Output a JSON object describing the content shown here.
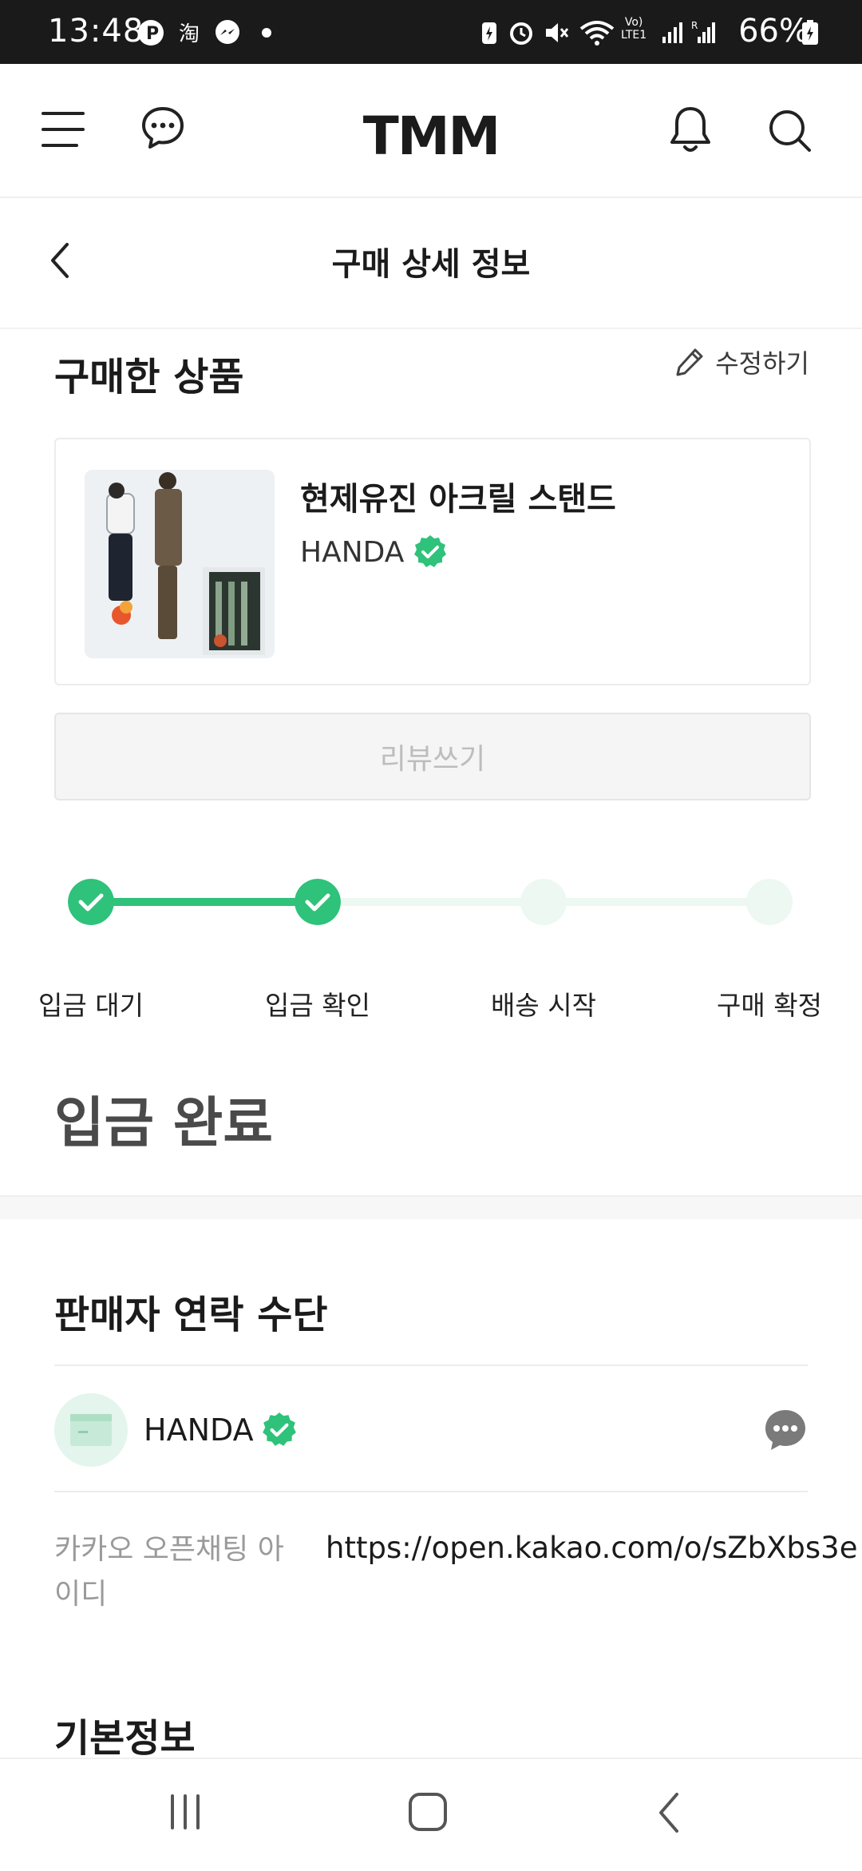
{
  "status_bar": {
    "time": "13:48",
    "battery": "66%",
    "icons": [
      "p-badge-icon",
      "taobao-icon",
      "messenger-icon",
      "dot-icon",
      "battery-saver-icon",
      "alarm-icon",
      "mute-icon",
      "wifi-icon",
      "volte-icon",
      "signal-icon",
      "signal-roaming-icon",
      "battery-icon"
    ]
  },
  "appbar": {
    "logo": "TMM",
    "icons": [
      "menu-icon",
      "chat-icon",
      "bell-icon",
      "search-icon"
    ]
  },
  "subheader": {
    "title": "구매 상세 정보"
  },
  "purchased": {
    "section_title": "구매한 상품",
    "edit_label": "수정하기",
    "product_name": "현제유진 아크릴 스탠드",
    "seller": "HANDA",
    "review_button": "리뷰쓰기"
  },
  "progress": {
    "steps": [
      {
        "label": "입금 대기",
        "done": true
      },
      {
        "label": "입금 확인",
        "done": true
      },
      {
        "label": "배송 시작",
        "done": false
      },
      {
        "label": "구매 확정",
        "done": false
      }
    ],
    "completed_steps": 2,
    "status": "입금 완료"
  },
  "contact": {
    "section_title": "판매자 연락 수단",
    "seller": "HANDA",
    "kakao_label": "카카오 오픈채팅 아이디",
    "kakao_value": "https://open.kakao.com/o/sZbXbs3e"
  },
  "basic_info": {
    "section_title": "기본정보"
  },
  "colors": {
    "accent": "#2fc27a",
    "accent_light": "#eef8f3",
    "status_bar": "#1a1a1a"
  }
}
